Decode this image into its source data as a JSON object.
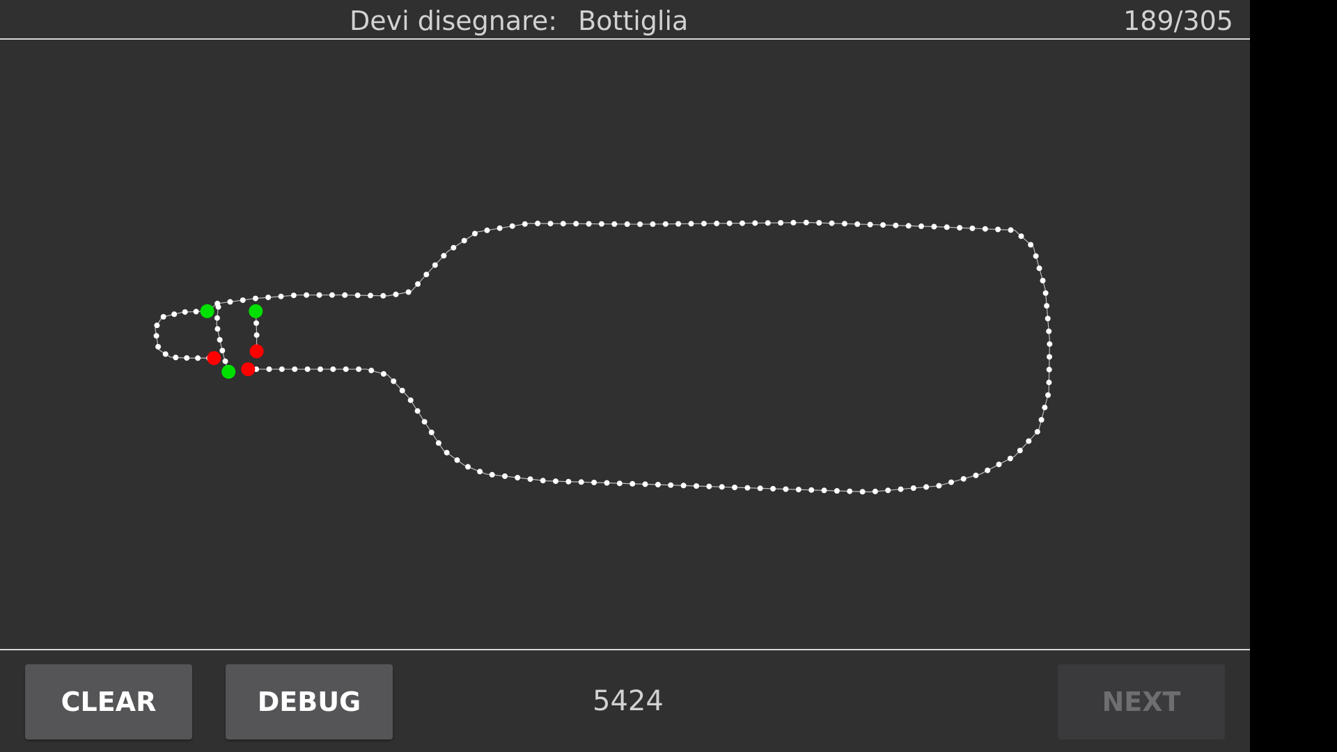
{
  "header": {
    "prompt_label": "Devi disegnare:",
    "prompt_word": "Bottiglia",
    "counter": "189/305"
  },
  "footer": {
    "clear_label": "CLEAR",
    "debug_label": "DEBUG",
    "score": "5424",
    "next_label": "NEXT",
    "next_enabled": false
  },
  "colors": {
    "background": "#303030",
    "stroke_point": "#ffffff",
    "stroke_line": "#bdbdbd",
    "start_marker": "#00e000",
    "end_marker": "#ff0000",
    "divider": "#d8d8d8"
  }
}
